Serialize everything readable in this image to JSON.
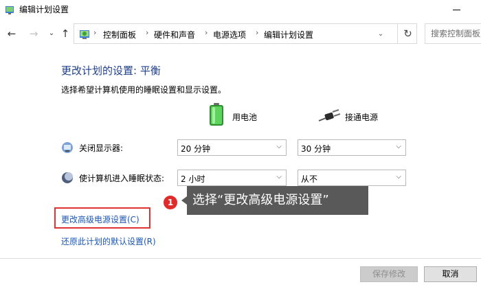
{
  "window": {
    "title": "编辑计划设置"
  },
  "addressbar": {
    "back_icon": "arrow-left",
    "forward_icon": "arrow-right",
    "recent_icon": "chevron-down",
    "up_icon": "arrow-up",
    "breadcrumbs": [
      "控制面板",
      "硬件和声音",
      "电源选项",
      "编辑计划设置"
    ],
    "search_placeholder": "搜索控制面板"
  },
  "main": {
    "heading": "更改计划的设置: 平衡",
    "subtitle": "选择希望计算机使用的睡眠设置和显示设置。",
    "columns": {
      "battery": "用电池",
      "plugged": "接通电源"
    },
    "settings": [
      {
        "label": "关闭显示器:",
        "battery_value": "20 分钟",
        "plugged_value": "30 分钟"
      },
      {
        "label": "使计算机进入睡眠状态:",
        "battery_value": "2 小时",
        "plugged_value": "从不"
      }
    ],
    "callout": {
      "number": "1",
      "text": "选择“更改高级电源设置”"
    },
    "links": {
      "advanced": "更改高级电源设置(C)",
      "restore": "还原此计划的默认设置(R)"
    }
  },
  "footer": {
    "save_label": "保存修改",
    "cancel_label": "取消"
  },
  "colors": {
    "heading": "#1e3f8a",
    "link": "#1a56b5",
    "highlight": "#e03030",
    "callout_bg": "#595959"
  }
}
